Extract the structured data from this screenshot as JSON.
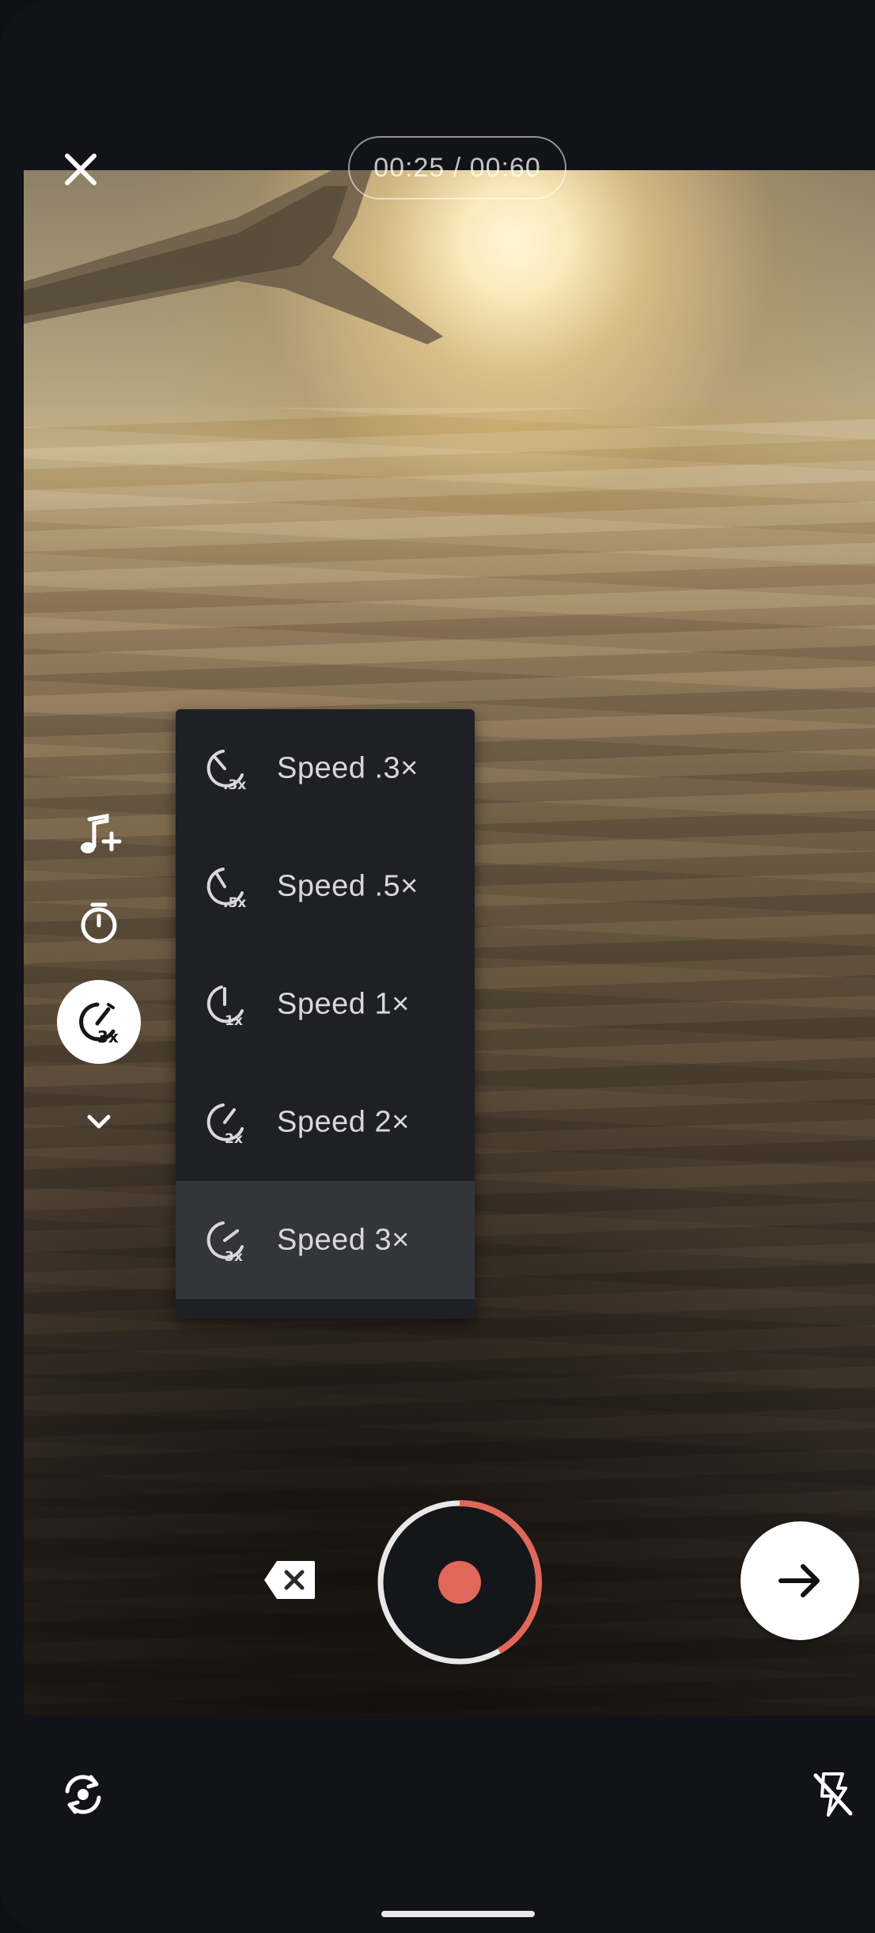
{
  "top_bar": {
    "close_icon": "close-icon",
    "timer_text": "00:25 / 00:60"
  },
  "side_tools": {
    "items": [
      {
        "icon": "music-add-icon",
        "active": false
      },
      {
        "icon": "timer-icon",
        "active": false
      },
      {
        "icon": "speed-3x-icon",
        "active": true
      },
      {
        "icon": "chevron-down-icon",
        "active": false
      }
    ]
  },
  "speed_menu": {
    "items": [
      {
        "label": "Speed .3×",
        "icon_badge": ".3x",
        "selected": false
      },
      {
        "label": "Speed .5×",
        "icon_badge": ".5x",
        "selected": false
      },
      {
        "label": "Speed 1×",
        "icon_badge": "1x",
        "selected": false
      },
      {
        "label": "Speed 2×",
        "icon_badge": "2x",
        "selected": false
      },
      {
        "label": "Speed 3×",
        "icon_badge": "3x",
        "selected": true
      }
    ]
  },
  "record": {
    "progress_fraction": 0.4167,
    "progress_color": "#e0685a",
    "button_color": "#e0685a"
  },
  "bottom_bar": {
    "flip_camera_icon": "flip-camera-icon",
    "flash_off_icon": "flash-off-icon"
  },
  "colors": {
    "accent": "#e0685a",
    "menu_bg": "#1f2026",
    "menu_selected": "#34353b"
  }
}
